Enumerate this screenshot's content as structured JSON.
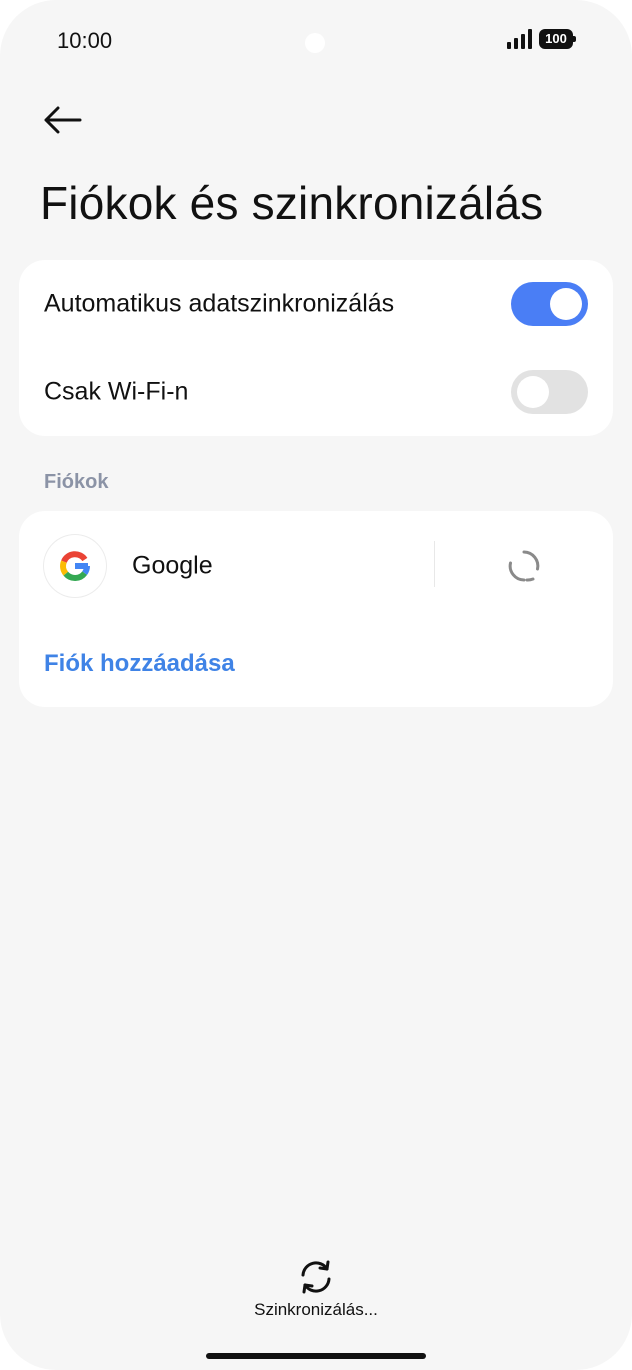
{
  "status_bar": {
    "time": "10:00",
    "battery": "100",
    "icons": [
      "signal-icon",
      "battery-icon"
    ]
  },
  "header": {
    "back_icon": "arrow-left-icon",
    "title": "Fiókok és szinkronizálás"
  },
  "sync_settings": {
    "items": [
      {
        "label": "Automatikus adatszinkronizálás",
        "enabled": true
      },
      {
        "label": "Csak Wi-Fi-n",
        "enabled": false
      }
    ]
  },
  "accounts": {
    "section_title": "Fiókok",
    "items": [
      {
        "name": "Google",
        "icon": "google-icon",
        "action_icon": "sync-icon"
      }
    ],
    "add_label": "Fiók hozzáadása"
  },
  "footer": {
    "sync_icon": "sync-icon",
    "sync_label": "Szinkronizálás..."
  },
  "colors": {
    "accent": "#4a7ef5",
    "link": "#3f83e6",
    "background": "#f6f6f6",
    "card": "#ffffff",
    "section_header": "#8b93a6",
    "toggle_off": "#e2e2e2"
  }
}
